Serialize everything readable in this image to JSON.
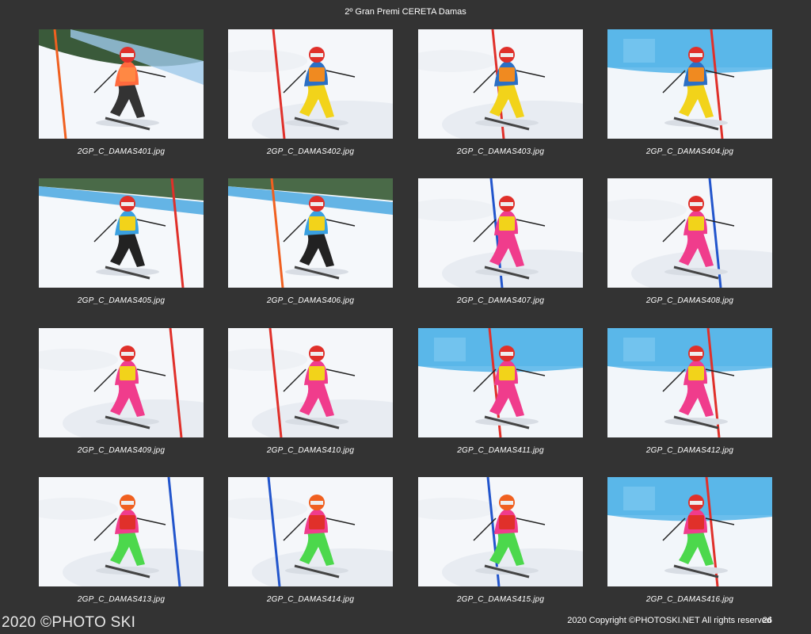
{
  "title": "2º Gran Premi CERETA Damas",
  "footer": {
    "watermark": "2020 ©PHOTO SKI",
    "copyright": "2020 Copyright ©PHOTOSKI.NET All rights reserved",
    "page_number": "26"
  },
  "photos": [
    {
      "filename": "2GP_C_DAMAS401.jpg",
      "scene": "fence",
      "suit": "#ff6a3d",
      "pants": "#333333",
      "pole": "#f06020",
      "bib": "#ff8844"
    },
    {
      "filename": "2GP_C_DAMAS402.jpg",
      "scene": "snow",
      "suit": "#2b6fc4",
      "pants": "#f2d31a",
      "pole": "#e0302a",
      "bib": "#f08a20"
    },
    {
      "filename": "2GP_C_DAMAS403.jpg",
      "scene": "snow",
      "suit": "#2b6fc4",
      "pants": "#f2d31a",
      "pole": "#e0302a",
      "bib": "#f08a20"
    },
    {
      "filename": "2GP_C_DAMAS404.jpg",
      "scene": "netting",
      "suit": "#2b6fc4",
      "pants": "#f2d31a",
      "pole": "#e0302a",
      "bib": "#f08a20"
    },
    {
      "filename": "2GP_C_DAMAS405.jpg",
      "scene": "trees",
      "suit": "#3aa0e0",
      "pants": "#222222",
      "pole": "#e0302a",
      "bib": "#f2d31a"
    },
    {
      "filename": "2GP_C_DAMAS406.jpg",
      "scene": "trees",
      "suit": "#3aa0e0",
      "pants": "#222222",
      "pole": "#f06020",
      "bib": "#f2d31a"
    },
    {
      "filename": "2GP_C_DAMAS407.jpg",
      "scene": "snow",
      "suit": "#f03c8c",
      "pants": "#f03c8c",
      "pole": "#2255cc",
      "bib": "#f2d31a"
    },
    {
      "filename": "2GP_C_DAMAS408.jpg",
      "scene": "snow",
      "suit": "#f03c8c",
      "pants": "#f03c8c",
      "pole": "#2255cc",
      "bib": "#f2d31a"
    },
    {
      "filename": "2GP_C_DAMAS409.jpg",
      "scene": "snow",
      "suit": "#f03c8c",
      "pants": "#f03c8c",
      "pole": "#e0302a",
      "bib": "#f2d31a"
    },
    {
      "filename": "2GP_C_DAMAS410.jpg",
      "scene": "snow",
      "suit": "#f03c8c",
      "pants": "#f03c8c",
      "pole": "#e0302a",
      "bib": "#f2d31a"
    },
    {
      "filename": "2GP_C_DAMAS411.jpg",
      "scene": "netting",
      "suit": "#f03c8c",
      "pants": "#f03c8c",
      "pole": "#e0302a",
      "bib": "#f2d31a"
    },
    {
      "filename": "2GP_C_DAMAS412.jpg",
      "scene": "netting",
      "suit": "#f03c8c",
      "pants": "#f03c8c",
      "pole": "#e0302a",
      "bib": "#f2d31a"
    },
    {
      "filename": "2GP_C_DAMAS413.jpg",
      "scene": "snow",
      "suit": "#f03c8c",
      "pants": "#4cd84c",
      "pole": "#2255cc",
      "bib": "#e0302a"
    },
    {
      "filename": "2GP_C_DAMAS414.jpg",
      "scene": "snow",
      "suit": "#f03c8c",
      "pants": "#4cd84c",
      "pole": "#2255cc",
      "bib": "#e0302a"
    },
    {
      "filename": "2GP_C_DAMAS415.jpg",
      "scene": "snow",
      "suit": "#f03c8c",
      "pants": "#4cd84c",
      "pole": "#2255cc",
      "bib": "#e0302a"
    },
    {
      "filename": "2GP_C_DAMAS416.jpg",
      "scene": "netting",
      "suit": "#f03c8c",
      "pants": "#4cd84c",
      "pole": "#e0302a",
      "bib": "#e0302a"
    }
  ]
}
